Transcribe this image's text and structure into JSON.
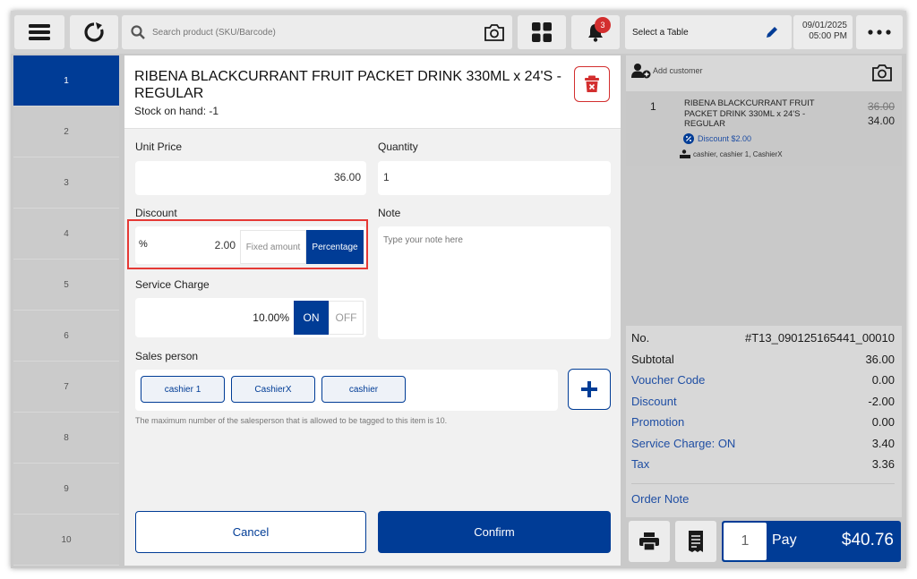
{
  "topbar": {
    "search_placeholder": "Search product (SKU/Barcode)",
    "notification_count": "3",
    "table_select": "Select a Table",
    "date": "09/01/2025",
    "time": "05:00 PM"
  },
  "tables": [
    "1",
    "2",
    "3",
    "4",
    "5",
    "6",
    "7",
    "8",
    "9",
    "10"
  ],
  "modal": {
    "title": "RIBENA BLACKCURRANT FRUIT PACKET DRINK 330ML x 24'S - REGULAR",
    "stock": "Stock on hand: -1",
    "unit_price_label": "Unit Price",
    "unit_price": "36.00",
    "quantity_label": "Quantity",
    "quantity": "1",
    "discount_label": "Discount",
    "discount_symbol": "%",
    "discount_value": "2.00",
    "fixed_amount": "Fixed amount",
    "percentage": "Percentage",
    "note_label": "Note",
    "note_placeholder": "Type your note here",
    "service_charge_label": "Service Charge",
    "service_charge_value": "10.00%",
    "on": "ON",
    "off": "OFF",
    "sales_person_label": "Sales person",
    "sales_persons": [
      "cashier 1",
      "CashierX",
      "cashier"
    ],
    "hint": "The maximum number of the salesperson that is allowed to be tagged to this item is 10.",
    "cancel": "Cancel",
    "confirm": "Confirm"
  },
  "order": {
    "add_customer": "Add customer",
    "item_qty": "1",
    "item_name": "RIBENA BLACKCURRANT FRUIT PACKET DRINK 330ML x 24'S - REGULAR",
    "item_discount": "Discount $2.00",
    "item_staff": "cashier, cashier 1, CashierX",
    "item_original_price": "36.00",
    "item_price": "34.00",
    "no_label": "No.",
    "no_value": "#T13_090125165441_00010",
    "rows": [
      {
        "label": "Subtotal",
        "value": "36.00",
        "blue": false
      },
      {
        "label": "Voucher Code",
        "value": "0.00",
        "blue": true
      },
      {
        "label": "Discount",
        "value": "-2.00",
        "blue": true
      },
      {
        "label": "Promotion",
        "value": "0.00",
        "blue": true
      },
      {
        "label": "Service Charge: ON",
        "value": "3.40",
        "blue": true
      },
      {
        "label": "Tax",
        "value": "3.36",
        "blue": true
      }
    ],
    "order_note": "Order Note",
    "pay_count": "1",
    "pay_label": "Pay",
    "pay_total": "$40.76"
  },
  "colors": {
    "primary": "#003c96",
    "danger": "#d32f2f"
  }
}
